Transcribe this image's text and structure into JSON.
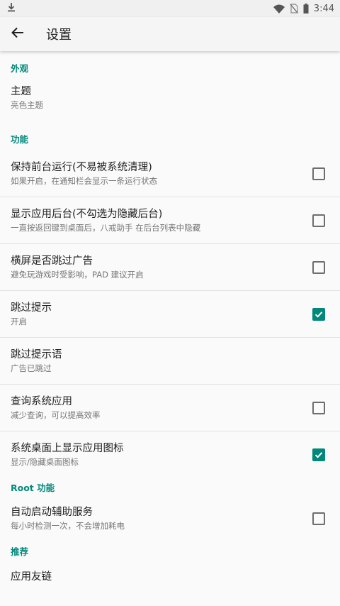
{
  "status_bar": {
    "time": "3:44"
  },
  "toolbar": {
    "title": "设置"
  },
  "sections": [
    {
      "header": "外观",
      "items": [
        {
          "title": "主题",
          "summary": "亮色主题",
          "checkbox": null
        }
      ]
    },
    {
      "header": "功能",
      "items": [
        {
          "title": "保持前台运行(不易被系统清理)",
          "summary": "如果开启，在通知栏会显示一条运行状态",
          "checkbox": false
        },
        {
          "title": "显示应用后台(不勾选为隐藏后台)",
          "summary": "一直按返回键到桌面后，八戒助手 在后台列表中隐藏",
          "checkbox": false
        },
        {
          "title": "横屏是否跳过广告",
          "summary": "避免玩游戏时受影响，PAD 建议开启",
          "checkbox": false
        },
        {
          "title": "跳过提示",
          "summary": "开启",
          "checkbox": true
        },
        {
          "title": "跳过提示语",
          "summary": "广告已跳过",
          "checkbox": null
        },
        {
          "title": "查询系统应用",
          "summary": "减少查询，可以提高效率",
          "checkbox": false
        },
        {
          "title": "系统桌面上显示应用图标",
          "summary": "显示/隐藏桌面图标",
          "checkbox": true
        }
      ]
    },
    {
      "header": "Root 功能",
      "items": [
        {
          "title": "自动启动辅助服务",
          "summary": "每小时检测一次，不会增加耗电",
          "checkbox": false
        }
      ]
    },
    {
      "header": "推荐",
      "items": [
        {
          "title": "应用友链",
          "summary": "",
          "checkbox": null
        }
      ]
    }
  ],
  "colors": {
    "accent": "#00897b",
    "toolbar_bg": "#f5f5f5",
    "page_bg": "#fafafa"
  },
  "icons": {
    "status": [
      "download-icon",
      "wifi-icon",
      "no-sim-icon",
      "battery-icon"
    ],
    "toolbar": "back-arrow-icon"
  }
}
